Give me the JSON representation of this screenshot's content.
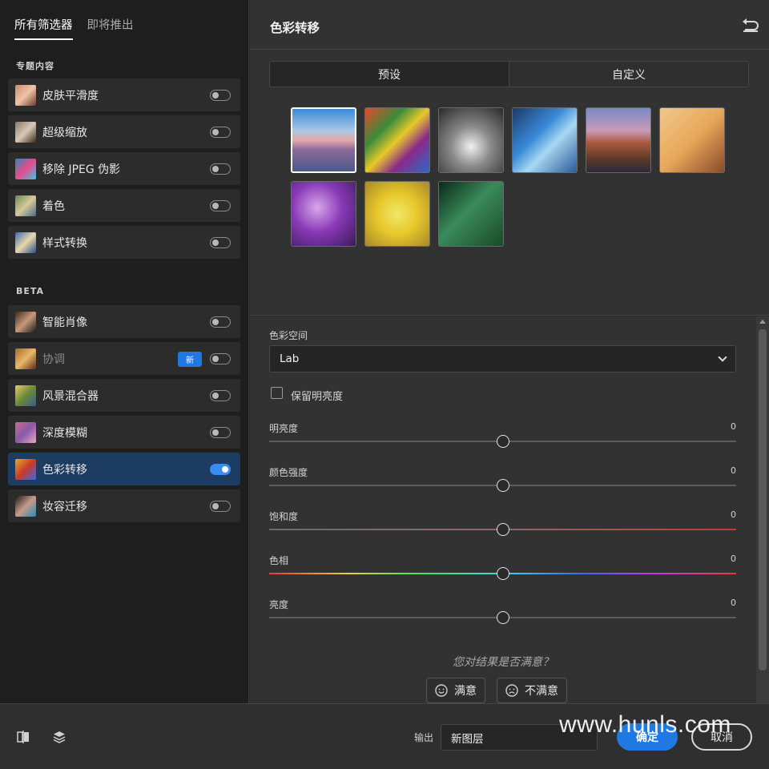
{
  "sidebar": {
    "tabs": [
      {
        "label": "所有筛选器",
        "active": true
      },
      {
        "label": "即将推出",
        "active": false
      }
    ],
    "featured_label": "专题内容",
    "featured": [
      {
        "label": "皮肤平滑度",
        "on": false,
        "thumb": "linear-gradient(135deg,#c98a6a,#f0c4a8,#6a3a2a)"
      },
      {
        "label": "超级缩放",
        "on": false,
        "thumb": "linear-gradient(135deg,#8a7a6a,#d8c8b8,#3a2a1a)"
      },
      {
        "label": "移除 JPEG 伪影",
        "on": false,
        "thumb": "linear-gradient(135deg,#2a8ab8,#e84a8a,#3ac8e8)"
      },
      {
        "label": "着色",
        "on": false,
        "thumb": "linear-gradient(135deg,#6a8a5a,#d8c89a,#4a6a8a)"
      },
      {
        "label": "样式转换",
        "on": false,
        "thumb": "linear-gradient(135deg,#3a6ab8,#e8d8a8,#2a4a8a)"
      }
    ],
    "beta_label": "BETA",
    "beta": [
      {
        "label": "智能肖像",
        "on": false,
        "dim": false,
        "badge": "",
        "thumb": "linear-gradient(135deg,#3a2a1a,#c89a7a,#1a1a1a)"
      },
      {
        "label": "协调",
        "on": false,
        "dim": true,
        "badge": "新",
        "thumb": "linear-gradient(135deg,#a86a2a,#e8b86a,#5a2a1a)"
      },
      {
        "label": "风景混合器",
        "on": false,
        "dim": false,
        "badge": "",
        "thumb": "linear-gradient(135deg,#e8c86a,#6a8a3a,#3a5a8a)"
      },
      {
        "label": "深度模糊",
        "on": false,
        "dim": false,
        "badge": "",
        "thumb": "linear-gradient(135deg,#c86a8a,#8a5aa8,#e8a8c8)"
      },
      {
        "label": "色彩转移",
        "on": true,
        "dim": false,
        "badge": "",
        "thumb": "linear-gradient(135deg,#e8a82a,#c83a2a,#3a6ae8)"
      },
      {
        "label": "妆容迁移",
        "on": false,
        "dim": false,
        "badge": "",
        "thumb": "linear-gradient(135deg,#1a1a1a,#c89a8a,#2a8ab8)"
      }
    ]
  },
  "panel": {
    "title": "色彩转移",
    "segments": [
      {
        "label": "预设",
        "active": true
      },
      {
        "label": "自定义",
        "active": false
      }
    ],
    "presets": [
      {
        "name": "sunset-sea",
        "selected": true,
        "bg": "linear-gradient(to bottom,#3a8ad8 0%,#a8c8e8 35%,#e8a8a8 50%,#8a6a9a 65%,#4a5a8a 100%)"
      },
      {
        "name": "abstract-paint",
        "selected": false,
        "bg": "linear-gradient(135deg,#e84a2a 0%,#3a8a3a 30%,#e8c82a 50%,#8a2a8a 70%,#2a6ac8 100%)"
      },
      {
        "name": "cathedral",
        "selected": false,
        "bg": "radial-gradient(circle at 50% 60%,#f0f0f0 0%,#8a8a8a 40%,#2a2a2a 100%)"
      },
      {
        "name": "blue-feathers",
        "selected": false,
        "bg": "linear-gradient(135deg,#1a3a6a 0%,#3a8ad8 40%,#a8d8f0 60%,#2a5a9a 100%)"
      },
      {
        "name": "desert-road",
        "selected": false,
        "bg": "linear-gradient(to bottom,#7a8ac8 0%,#c89ab8 35%,#a8583a 55%,#5a3a2a 80%,#2a2a3a 100%)"
      },
      {
        "name": "skateboarder",
        "selected": false,
        "bg": "linear-gradient(135deg,#f0c88a 0%,#e8a85a 50%,#8a4a2a 100%)"
      },
      {
        "name": "purple-flowers",
        "selected": false,
        "bg": "radial-gradient(circle at 40% 40%,#d8a8e8 0%,#8a3ab8 45%,#3a1a5a 100%)"
      },
      {
        "name": "yellow-flower",
        "selected": false,
        "bg": "radial-gradient(circle at 50% 50%,#f0e86a 0%,#e8c82a 45%,#a8882a 100%)"
      },
      {
        "name": "green-leaves",
        "selected": false,
        "bg": "linear-gradient(135deg,#0a2a1a 0%,#3a8a5a 45%,#1a4a2a 100%)"
      }
    ]
  },
  "settings": {
    "color_space_label": "色彩空间",
    "color_space_value": "Lab",
    "preserve_label": "保留明亮度",
    "sliders": [
      {
        "label": "明亮度",
        "value": "0",
        "position": 0.5,
        "track": "plain"
      },
      {
        "label": "颜色强度",
        "value": "0",
        "position": 0.5,
        "track": "plain"
      },
      {
        "label": "饱和度",
        "value": "0",
        "position": 0.5,
        "track": "sat"
      },
      {
        "label": "色相",
        "value": "0",
        "position": 0.5,
        "track": "hue"
      },
      {
        "label": "亮度",
        "value": "0",
        "position": 0.5,
        "track": "plain"
      }
    ],
    "feedback_question": "您对结果是否满意？",
    "satisfied_label": "满意",
    "dissatisfied_label": "不满意"
  },
  "footer": {
    "output_label": "输出",
    "output_value": "新图层",
    "ok_label": "确定",
    "cancel_label": "取消"
  },
  "watermark": "www.hunls.com",
  "colors": {
    "accent": "#1e79e3",
    "active_item": "#1d3c62",
    "panel_bg": "#323232",
    "sidebar_bg": "#1e1e1e"
  }
}
